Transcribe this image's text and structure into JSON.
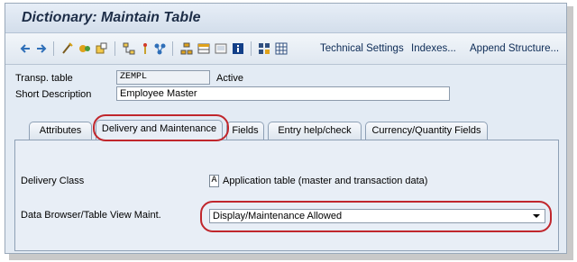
{
  "window": {
    "title": "Dictionary: Maintain Table"
  },
  "toolbar": {
    "icons": [
      "back-arrow-icon",
      "forward-arrow-icon",
      "display-change-icon",
      "active-inactive-icon",
      "other-object-icon",
      "where-used-icon",
      "check-icon",
      "activate-icon",
      "hierarchy-icon",
      "layout-icon",
      "screen-icon",
      "info-icon",
      "grid-icon",
      "table-icon"
    ],
    "technical_settings": "Technical Settings",
    "indexes": "Indexes...",
    "append_structure": "Append Structure..."
  },
  "header": {
    "transp_table_label": "Transp. table",
    "transp_table_value": "ZEMPL",
    "status": "Active",
    "short_description_label": "Short Description",
    "short_description_value": "Employee Master"
  },
  "tabs": [
    {
      "label": "Attributes"
    },
    {
      "label": "Delivery and Maintenance"
    },
    {
      "label": "Fields"
    },
    {
      "label": "Entry help/check"
    },
    {
      "label": "Currency/Quantity Fields"
    }
  ],
  "delivery": {
    "delivery_class_label": "Delivery Class",
    "delivery_class_value": "A",
    "delivery_class_text": "Application table (master and transaction data)",
    "browser_label": "Data Browser/Table View Maint.",
    "browser_value": "Display/Maintenance Allowed"
  },
  "colors": {
    "highlight": "#c0262c",
    "title_bar": "#d3deeb",
    "panel": "#e8eef6"
  }
}
